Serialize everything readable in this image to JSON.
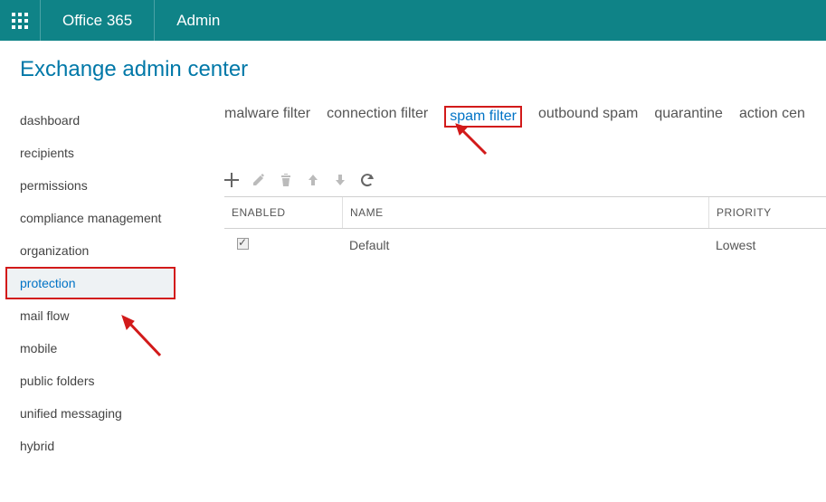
{
  "topbar": {
    "product": "Office 365",
    "section": "Admin"
  },
  "page_title": "Exchange admin center",
  "sidebar": {
    "items": [
      {
        "label": "dashboard"
      },
      {
        "label": "recipients"
      },
      {
        "label": "permissions"
      },
      {
        "label": "compliance management"
      },
      {
        "label": "organization"
      },
      {
        "label": "protection",
        "active": true,
        "highlighted": true
      },
      {
        "label": "mail flow"
      },
      {
        "label": "mobile"
      },
      {
        "label": "public folders"
      },
      {
        "label": "unified messaging"
      },
      {
        "label": "hybrid"
      }
    ]
  },
  "tabs": [
    {
      "label": "malware filter"
    },
    {
      "label": "connection filter"
    },
    {
      "label": "spam filter",
      "active": true,
      "highlighted": true
    },
    {
      "label": "outbound spam"
    },
    {
      "label": "quarantine"
    },
    {
      "label": "action cen"
    }
  ],
  "toolbar": {
    "add": "add",
    "edit": "edit",
    "delete": "delete",
    "up": "move up",
    "down": "move down",
    "refresh": "refresh"
  },
  "table": {
    "headers": {
      "enabled": "ENABLED",
      "name": "NAME",
      "priority": "PRIORITY"
    },
    "rows": [
      {
        "enabled": true,
        "name": "Default",
        "priority": "Lowest"
      }
    ]
  }
}
